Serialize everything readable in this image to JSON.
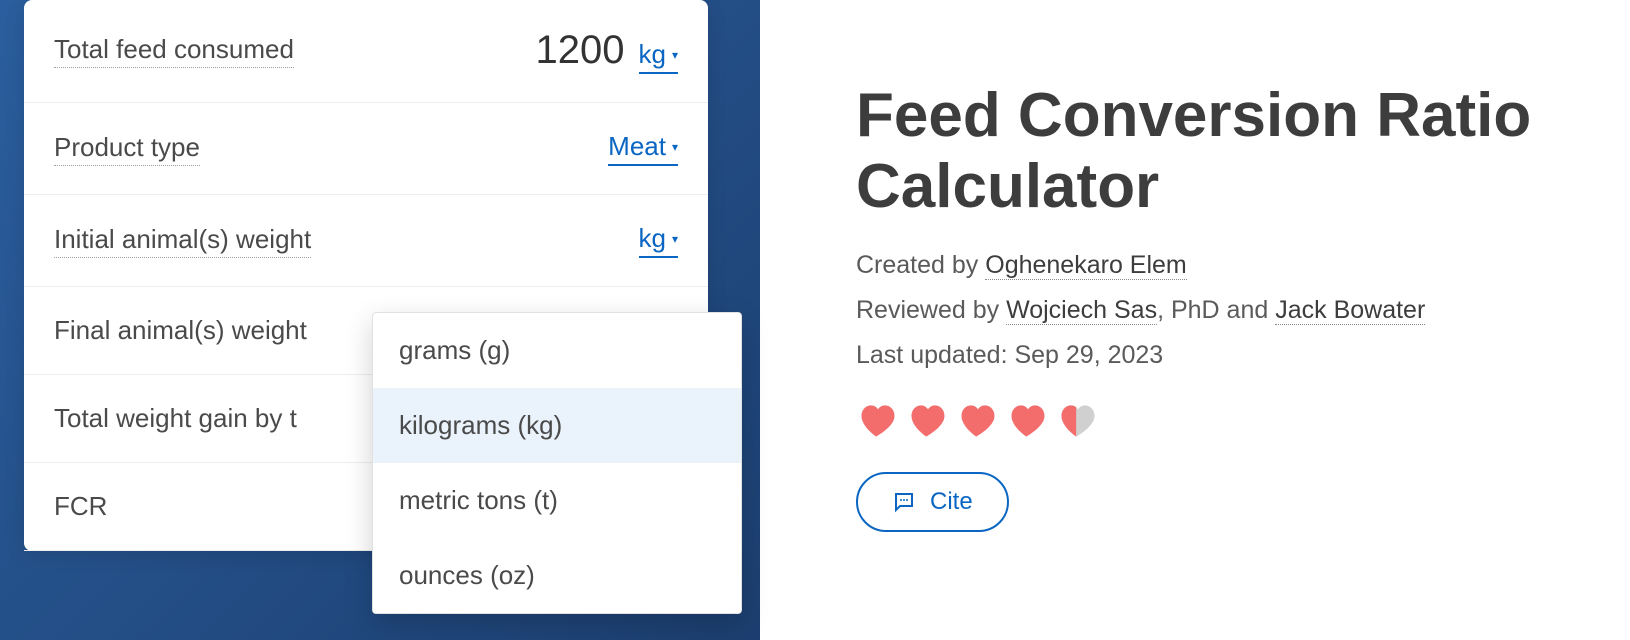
{
  "calc": {
    "feed": {
      "label": "Total feed consumed",
      "value": "1200",
      "unit": "kg"
    },
    "product": {
      "label": "Product type",
      "value": "Meat"
    },
    "initial": {
      "label": "Initial animal(s) weight",
      "unit": "kg"
    },
    "final": {
      "label": "Final animal(s) weight"
    },
    "gain": {
      "label": "Total weight gain by t"
    },
    "fcr": {
      "label": "FCR"
    },
    "unit_options": [
      {
        "label": "grams (g)"
      },
      {
        "label": "kilograms (kg)",
        "selected": true
      },
      {
        "label": "metric tons (t)"
      },
      {
        "label": "ounces (oz)"
      }
    ]
  },
  "article": {
    "title": "Feed Conversion Ratio Calculator",
    "created_prefix": "Created by ",
    "created_by": "Oghenekaro Elem",
    "reviewed_prefix": "Reviewed by ",
    "reviewer1": "Wojciech Sas",
    "reviewer1_suffix": ", PhD and ",
    "reviewer2": "Jack Bowater",
    "updated": "Last updated: Sep 29, 2023",
    "rating_full": 4,
    "rating_half": true,
    "cite": "Cite"
  }
}
